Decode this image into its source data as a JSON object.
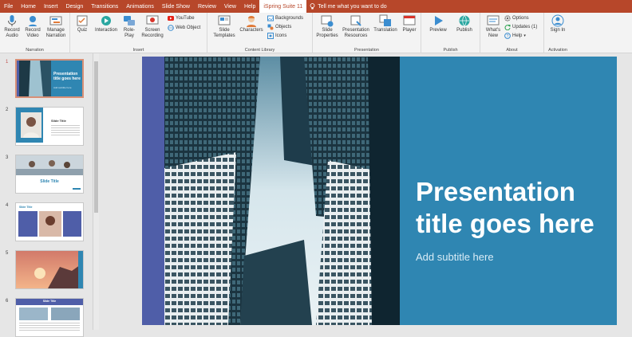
{
  "menu": [
    "File",
    "Home",
    "Insert",
    "Design",
    "Transitions",
    "Animations",
    "Slide Show",
    "Review",
    "View",
    "Help",
    "iSpring Suite 11"
  ],
  "tell_me": "Tell me what you want to do",
  "ribbon": {
    "narration": {
      "label": "Narration",
      "record_audio": "Record Audio",
      "record_video": "Record Video",
      "manage_narration": "Manage Narration"
    },
    "insert": {
      "label": "Insert",
      "quiz": "Quiz",
      "interaction": "Interaction",
      "roleplay": "Role-Play",
      "screen_recording": "Screen Recording",
      "youtube": "YouTube",
      "web_object": "Web Object"
    },
    "content_library": {
      "label": "Content Library",
      "slide_templates": "Slide Templates",
      "characters": "Characters",
      "backgrounds": "Backgrounds",
      "objects": "Objects",
      "icons": "Icons"
    },
    "presentation": {
      "label": "Presentation",
      "slide_properties": "Slide Properties",
      "presentation_resources": "Presentation Resources",
      "translation": "Translation",
      "player": "Player"
    },
    "publish": {
      "label": "Publish",
      "preview": "Preview",
      "publish": "Publish"
    },
    "about": {
      "label": "About",
      "whats_new": "What's New",
      "options": "Options",
      "updates": "Updates (1)",
      "help": "Help"
    },
    "activation": {
      "label": "Activation",
      "sign_in": "Sign In"
    }
  },
  "thumbnails": [
    {
      "num": "1",
      "title": "Presentation title goes here",
      "sub": "Add subtitle here"
    },
    {
      "num": "2",
      "title": "Slide Title"
    },
    {
      "num": "3",
      "title": "Slide Title"
    },
    {
      "num": "4",
      "title": "Slide Title"
    },
    {
      "num": "5"
    },
    {
      "num": "6",
      "title": "Slide Title"
    }
  ],
  "slide": {
    "title": "Presentation title goes here",
    "subtitle": "Add subtitle here"
  },
  "colors": {
    "accent": "#b7472a",
    "slide_blue": "#2f86b2",
    "strip": "#4f5ea8"
  }
}
